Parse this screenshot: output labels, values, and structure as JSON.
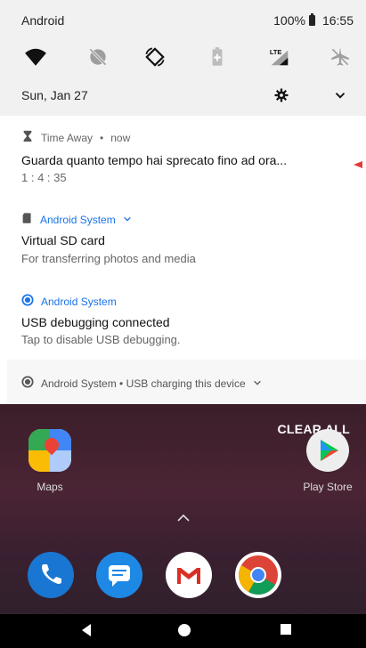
{
  "status_bar": {
    "carrier": "Android",
    "battery": "100%",
    "time": "16:55"
  },
  "quick_settings": {
    "tiles": [
      {
        "name": "wifi-icon"
      },
      {
        "name": "do-not-disturb-off-icon"
      },
      {
        "name": "auto-rotate-icon"
      },
      {
        "name": "battery-saver-icon"
      },
      {
        "name": "lte-signal-icon",
        "label": "LTE"
      },
      {
        "name": "airplane-mode-icon"
      }
    ],
    "date": "Sun, Jan 27"
  },
  "notifications": [
    {
      "app": "Time Away",
      "time": "now",
      "title": "Guarda quanto tempo hai sprecato fino ad ora...",
      "body": "1 : 4 : 35"
    },
    {
      "app": "Android System",
      "title": "Virtual SD card",
      "body": "For transferring photos and media"
    },
    {
      "app": "Android System",
      "title": "USB debugging connected",
      "body": "Tap to disable USB debugging."
    }
  ],
  "collapsed_notification": {
    "text": "Android System • USB charging this device"
  },
  "home": {
    "clear_all": "CLEAR ALL",
    "apps": [
      {
        "label": "Maps"
      },
      {
        "label": "Play Store"
      }
    ],
    "dock": [
      "Phone",
      "Messages",
      "Gmail",
      "Chrome"
    ]
  },
  "colors": {
    "accent_blue": "#1a73e8",
    "red_arrow": "#e53935"
  }
}
